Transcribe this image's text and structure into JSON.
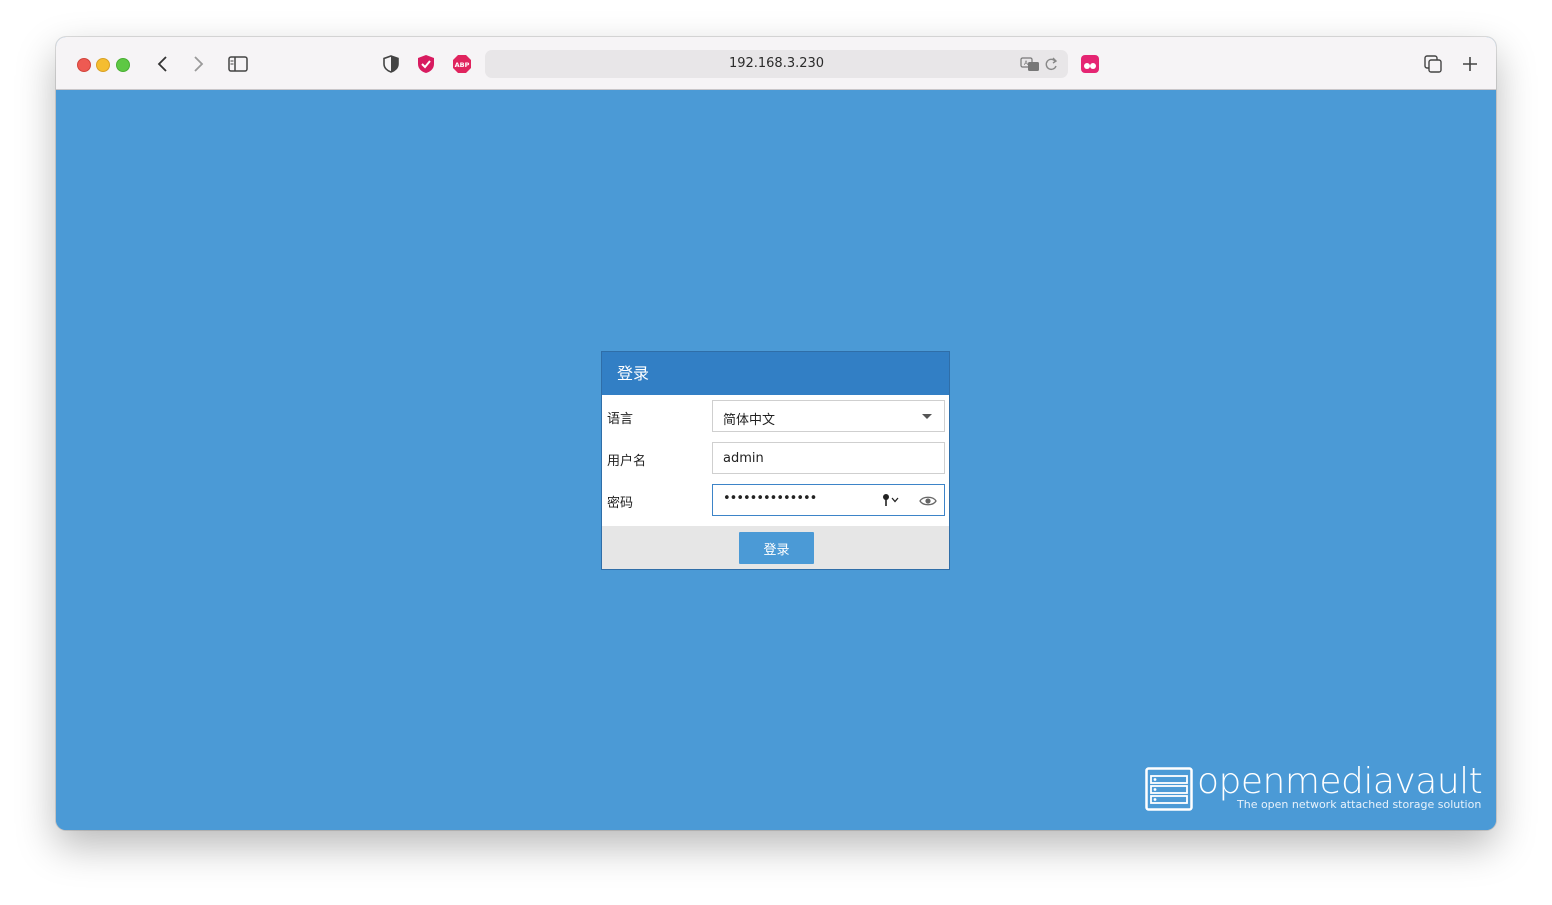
{
  "browser": {
    "url": "192.168.3.230"
  },
  "dialog": {
    "title": "登录",
    "fields": {
      "language": {
        "label": "语言",
        "value": "简体中文"
      },
      "username": {
        "label": "用户名",
        "value": "admin"
      },
      "password": {
        "label": "密码",
        "value": "••••••••••••••"
      }
    },
    "login_button": "登录"
  },
  "brand": {
    "name": "openmediavault",
    "tagline": "The open network attached storage solution"
  },
  "colors": {
    "page_background": "#4b9ad6",
    "dialog_header": "#327fc5",
    "button": "#4b9ad6"
  },
  "icons": [
    "back-icon",
    "forward-icon",
    "sidebar-icon",
    "privacy-shield-icon",
    "extension-check-icon",
    "adblock-icon",
    "translate-icon",
    "reload-icon",
    "extension-pink-icon",
    "tabs-overview-icon",
    "new-tab-icon",
    "dropdown-caret-icon",
    "password-key-icon",
    "show-password-eye-icon",
    "storage-server-logo-icon"
  ]
}
